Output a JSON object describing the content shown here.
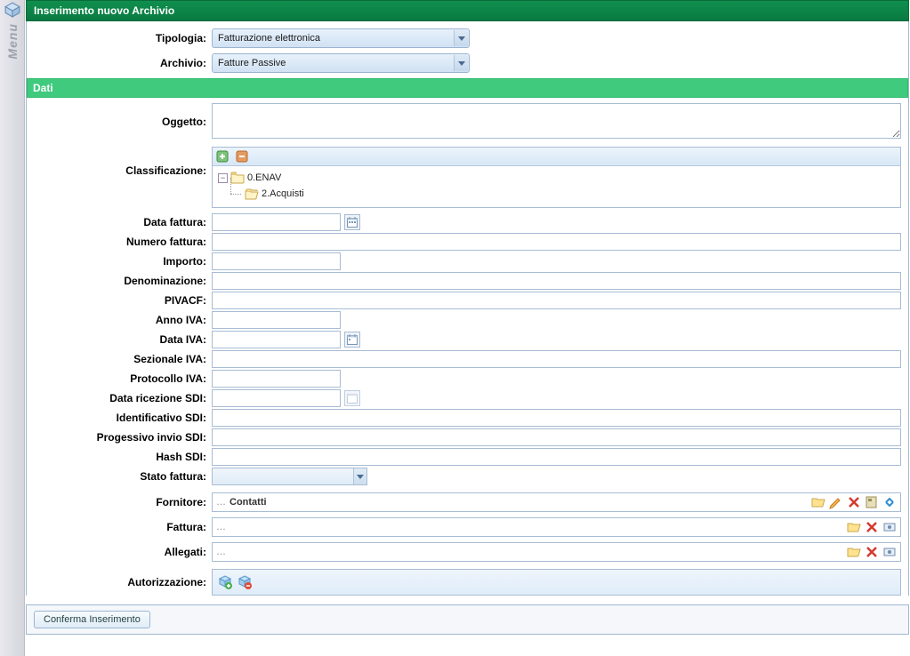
{
  "menuRail": {
    "label": "Menu"
  },
  "window": {
    "title": "Inserimento nuovo Archivio"
  },
  "header": {
    "tipologia_label": "Tipologia:",
    "tipologia_value": "Fatturazione elettronica",
    "archivio_label": "Archivio:",
    "archivio_value": "Fatture Passive"
  },
  "section": {
    "dati": "Dati"
  },
  "fields": {
    "oggetto": "Oggetto:",
    "classificazione": "Classificazione:",
    "data_fattura": "Data fattura:",
    "numero_fattura": "Numero fattura:",
    "importo": "Importo:",
    "denominazione": "Denominazione:",
    "pivacf": "PIVACF:",
    "anno_iva": "Anno IVA:",
    "data_iva": "Data IVA:",
    "sezionale_iva": "Sezionale IVA:",
    "protocollo_iva": "Protocollo IVA:",
    "data_ricezione_sdi": "Data ricezione SDI:",
    "identificativo_sdi": "Identificativo SDI:",
    "progessivo_invio_sdi": "Progessivo invio SDI:",
    "hash_sdi": "Hash SDI:",
    "stato_fattura": "Stato fattura:",
    "fornitore": "Fornitore:",
    "fattura": "Fattura:",
    "allegati": "Allegati:",
    "autorizzazione": "Autorizzazione:"
  },
  "tree": {
    "root": "0.ENAV",
    "child": "2.Acquisti"
  },
  "lookup": {
    "contatti": "Contatti",
    "dots": "…"
  },
  "buttons": {
    "conferma": "Conferma Inserimento"
  }
}
